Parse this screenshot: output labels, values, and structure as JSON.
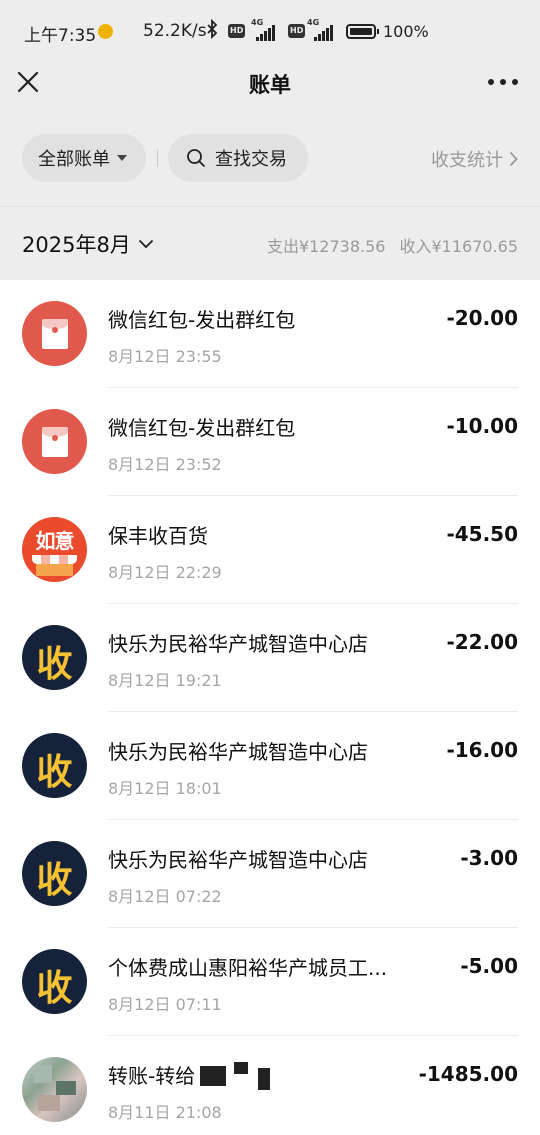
{
  "status_bar": {
    "time": "上午7:35",
    "speed": "52.2K/s",
    "network_1": "4G",
    "network_2": "4G",
    "hd_1": "HD",
    "hd_2": "HD",
    "battery": "100%"
  },
  "nav": {
    "title": "账单",
    "close_icon": "close-icon",
    "more_icon": "more-dots-icon"
  },
  "filters": {
    "all_bills": "全部账单",
    "search": "查找交易",
    "stats": "收支统计"
  },
  "month": {
    "label": "2025年8月",
    "expense": "支出¥12738.56",
    "income": "收入¥11670.65"
  },
  "transactions": [
    {
      "title": "微信红包-发出群红包",
      "time": "8月12日 23:55",
      "amount": "-20.00",
      "icon": "red-packet-icon"
    },
    {
      "title": "微信红包-发出群红包",
      "time": "8月12日 23:52",
      "amount": "-10.00",
      "icon": "red-packet-icon"
    },
    {
      "title": "保丰收百货",
      "time": "8月12日 22:29",
      "amount": "-45.50",
      "icon": "ruyi-store-icon",
      "icon_text": "如意"
    },
    {
      "title": "快乐为民裕华产城智造中心店",
      "time": "8月12日 19:21",
      "amount": "-22.00",
      "icon": "shou-icon",
      "icon_text": "收"
    },
    {
      "title": "快乐为民裕华产城智造中心店",
      "time": "8月12日 18:01",
      "amount": "-16.00",
      "icon": "shou-icon",
      "icon_text": "收"
    },
    {
      "title": "快乐为民裕华产城智造中心店",
      "time": "8月12日 07:22",
      "amount": "-3.00",
      "icon": "shou-icon",
      "icon_text": "收"
    },
    {
      "title": "个体费成山惠阳裕华产城员工...",
      "time": "8月12日 07:11",
      "amount": "-5.00",
      "icon": "shou-icon",
      "icon_text": "收"
    },
    {
      "title": "转账-转给",
      "time": "8月11日 21:08",
      "amount": "-1485.00",
      "icon": "user-avatar"
    }
  ],
  "colors": {
    "background": "#ededed",
    "list_bg": "#ffffff",
    "red_packet": "#e0594c",
    "ruyi": "#ea4b2d",
    "shou_bg": "#16213a",
    "shou_fg": "#f3c133",
    "muted": "#9a9a9a"
  }
}
